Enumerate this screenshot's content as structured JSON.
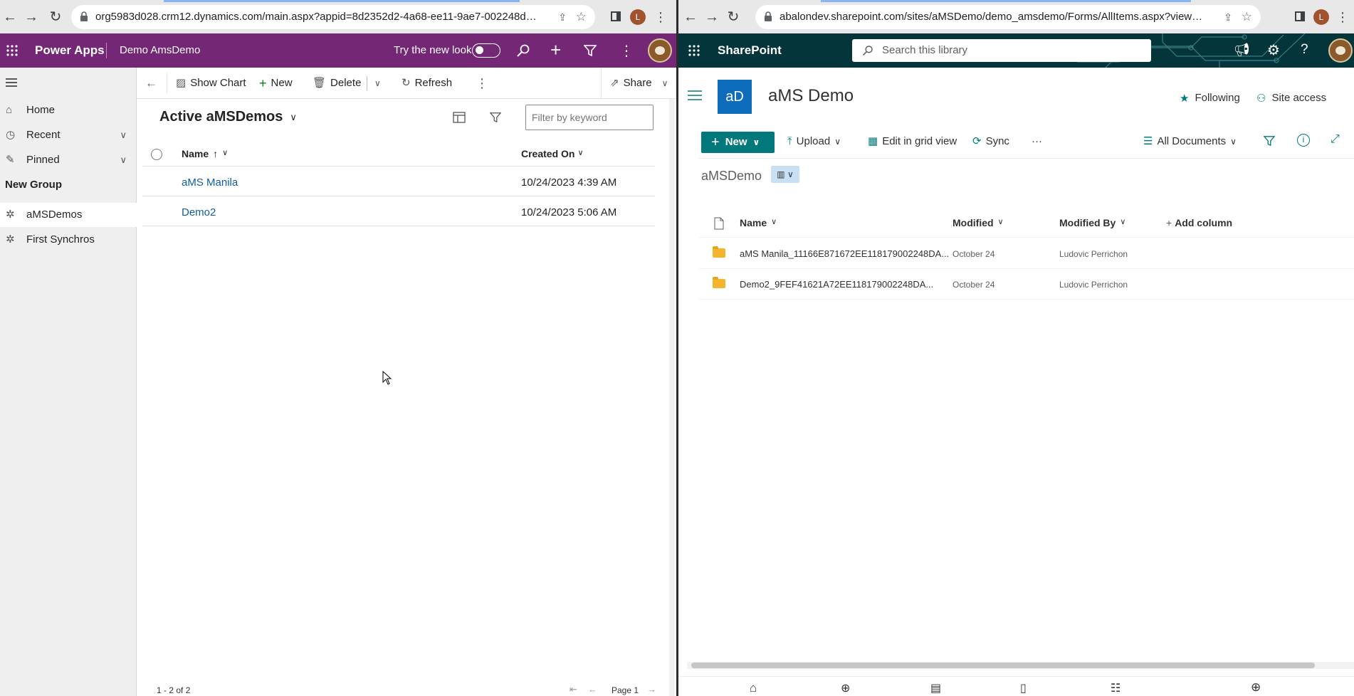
{
  "left_browser": {
    "url": "org5983d028.crm12.dynamics.com/main.aspx?appid=8d2352d2-4a68-ee11-9ae7-002248da63d9&pa...",
    "profile_initial": "L"
  },
  "powerapps": {
    "brand": "Power Apps",
    "app_name": "Demo AmsDemo",
    "try_new_look": "Try the new look",
    "commands": {
      "show_chart": "Show Chart",
      "new": "New",
      "delete": "Delete",
      "refresh": "Refresh",
      "share": "Share"
    },
    "sidebar": {
      "items": [
        {
          "label": "Home"
        },
        {
          "label": "Recent"
        },
        {
          "label": "Pinned"
        }
      ],
      "group_label": "New Group",
      "group_items": [
        {
          "label": "aMSDemos"
        },
        {
          "label": "First Synchros"
        }
      ]
    },
    "view": {
      "title": "Active aMSDemos",
      "filter_placeholder": "Filter by keyword",
      "columns": [
        "Name",
        "Created On"
      ],
      "name_sort_indicator": "↑",
      "rows": [
        {
          "name": "aMS Manila",
          "created": "10/24/2023 4:39 AM"
        },
        {
          "name": "Demo2",
          "created": "10/24/2023 5:06 AM"
        }
      ],
      "record_count": "1 - 2 of 2",
      "page": "Page 1"
    }
  },
  "right_browser": {
    "url": "abalondev.sharepoint.com/sites/aMSDemo/demo_amsdemo/Forms/AllItems.aspx?viewid=4af22666-d...",
    "profile_initial": "L"
  },
  "sharepoint": {
    "brand": "SharePoint",
    "search_placeholder": "Search this library",
    "site_logo": "aD",
    "site_title": "aMS Demo",
    "following": "Following",
    "site_access": "Site access",
    "commands": {
      "new": "New",
      "upload": "Upload",
      "edit_grid": "Edit in grid view",
      "sync": "Sync",
      "more": "···",
      "view": "All Documents"
    },
    "library_name": "aMSDemo",
    "columns": {
      "name": "Name",
      "modified": "Modified",
      "modified_by": "Modified By",
      "add_column": "Add column"
    },
    "rows": [
      {
        "name": "aMS Manila_11166E871672EE118179002248DA...",
        "modified": "October 24",
        "modified_by": "Ludovic Perrichon"
      },
      {
        "name": "Demo2_9FEF41621A72EE118179002248DA...",
        "modified": "October 24",
        "modified_by": "Ludovic Perrichon"
      }
    ]
  },
  "colors": {
    "powerapps_purple": "#742774",
    "sharepoint_teal": "#03353b",
    "sp_accent": "#03787c",
    "site_logo_blue": "#0f6cbd"
  }
}
